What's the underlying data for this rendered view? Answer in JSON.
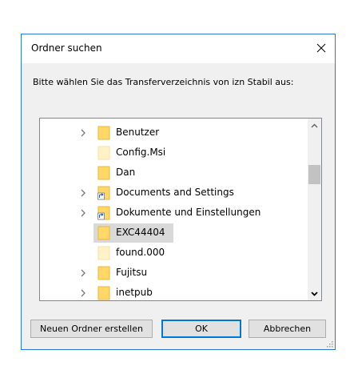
{
  "dialog": {
    "title": "Ordner suchen",
    "instruction": "Bitte wählen Sie das Transferverzeichnis von izn Stabil aus:"
  },
  "tree": {
    "items": [
      {
        "label": "Benutzer",
        "expandable": true,
        "shortcut": false,
        "icon": "folder-icon"
      },
      {
        "label": "Config.Msi",
        "expandable": false,
        "shortcut": false,
        "icon": "folder-icon",
        "faded": true
      },
      {
        "label": "Dan",
        "expandable": false,
        "shortcut": false,
        "icon": "folder-icon"
      },
      {
        "label": "Documents and Settings",
        "expandable": true,
        "shortcut": true,
        "icon": "shortcut-folder-icon"
      },
      {
        "label": "Dokumente und Einstellungen",
        "expandable": true,
        "shortcut": true,
        "icon": "shortcut-folder-icon"
      },
      {
        "label": "EXC44404",
        "expandable": false,
        "shortcut": false,
        "icon": "folder-icon",
        "selected": true
      },
      {
        "label": "found.000",
        "expandable": false,
        "shortcut": false,
        "icon": "folder-icon",
        "faded": true
      },
      {
        "label": "Fujitsu",
        "expandable": true,
        "shortcut": false,
        "icon": "folder-icon"
      },
      {
        "label": "inetpub",
        "expandable": true,
        "shortcut": false,
        "icon": "folder-icon"
      }
    ]
  },
  "buttons": {
    "new_folder": "Neuen Ordner erstellen",
    "ok": "OK",
    "cancel": "Abbrechen"
  },
  "colors": {
    "accent": "#0078d7",
    "window_border": "#2b79d7",
    "folder": "#ffd867",
    "folder_faded": "#fff2c6",
    "selection": "#d9d9d9"
  }
}
